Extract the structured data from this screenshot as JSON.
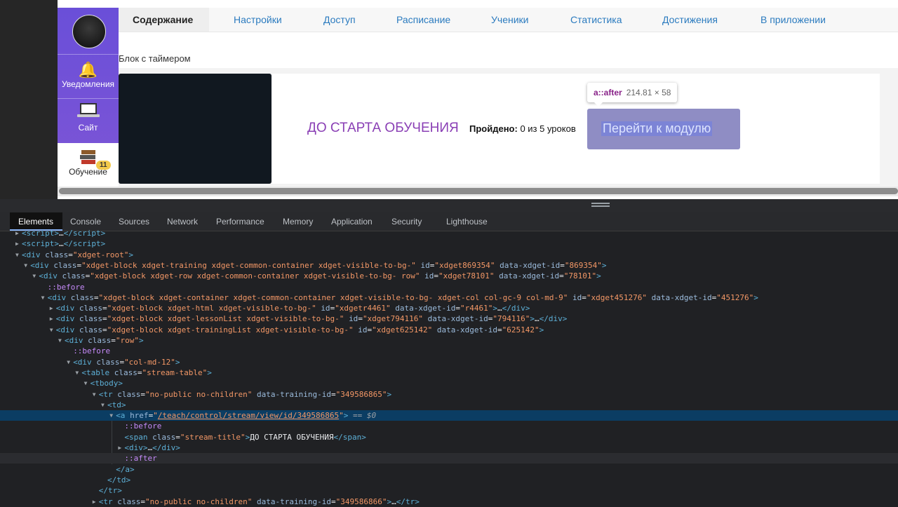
{
  "sidebar": {
    "items": [
      {
        "label": "Уведомления",
        "icon": "bell-icon"
      },
      {
        "label": "Сайт",
        "icon": "laptop-icon"
      },
      {
        "label": "Обучение",
        "icon": "books-icon",
        "badge": "11"
      }
    ]
  },
  "tabs": [
    {
      "label": "Содержание",
      "active": true
    },
    {
      "label": "Настройки"
    },
    {
      "label": "Доступ"
    },
    {
      "label": "Расписание"
    },
    {
      "label": "Ученики"
    },
    {
      "label": "Статистика"
    },
    {
      "label": "Достижения"
    },
    {
      "label": "В приложении"
    }
  ],
  "content": {
    "block_label": "Блок с таймером",
    "stream_title": "ДО СТАРТА ОБУЧЕНИЯ",
    "progress_label": "Пройдено:",
    "progress_value": " 0 из 5 уроков",
    "module_button": "Перейти к модулю"
  },
  "tooltip": {
    "selector": "a::after",
    "size": "214.81 × 58"
  },
  "devtools": {
    "tabs": [
      "Elements",
      "Console",
      "Sources",
      "Network",
      "Performance",
      "Memory",
      "Application",
      "Security",
      "Lighthouse"
    ],
    "active_tab": "Elements",
    "lines": [
      {
        "indent": 0,
        "arrow": "▶",
        "html": "<span class='tag'>&lt;script&gt;</span>…<span class='tag'>&lt;/script&gt;</span>"
      },
      {
        "indent": 0,
        "arrow": "▶",
        "html": "<span class='tag'>&lt;script&gt;</span>…<span class='tag'>&lt;/script&gt;</span>"
      },
      {
        "indent": 0,
        "arrow": "▼",
        "html": "<span class='tag'>&lt;div</span> <span class='attr'>class</span>=<span class='val'>\"xdget-root\"</span><span class='tag'>&gt;</span>"
      },
      {
        "indent": 1,
        "arrow": "▼",
        "html": "<span class='tag'>&lt;div</span> <span class='attr'>class</span>=<span class='val'>\"xdget-block xdget-training xdget-common-container xdget-visible-to-bg-\"</span> <span class='attr'>id</span>=<span class='val'>\"xdget869354\"</span> <span class='attr'>data-xdget-id</span>=<span class='val'>\"869354\"</span><span class='tag'>&gt;</span>"
      },
      {
        "indent": 2,
        "arrow": "▼",
        "html": "<span class='tag'>&lt;div</span> <span class='attr'>class</span>=<span class='val'>\"xdget-block xdget-row xdget-common-container xdget-visible-to-bg- row\"</span> <span class='attr'>id</span>=<span class='val'>\"xdget78101\"</span> <span class='attr'>data-xdget-id</span>=<span class='val'>\"78101\"</span><span class='tag'>&gt;</span>"
      },
      {
        "indent": 3,
        "arrow": "",
        "html": "<span class='pseudo'>::before</span>"
      },
      {
        "indent": 3,
        "arrow": "▼",
        "html": "<span class='tag'>&lt;div</span> <span class='attr'>class</span>=<span class='val'>\"xdget-block xdget-container xdget-common-container xdget-visible-to-bg- xdget-col col-gc-9 col-md-9\"</span> <span class='attr'>id</span>=<span class='val'>\"xdget451276\"</span> <span class='attr'>data-xdget-id</span>=<span class='val'>\"451276\"</span><span class='tag'>&gt;</span>"
      },
      {
        "indent": 4,
        "arrow": "▶",
        "html": "<span class='tag'>&lt;div</span> <span class='attr'>class</span>=<span class='val'>\"xdget-block xdget-html xdget-visible-to-bg-\"</span> <span class='attr'>id</span>=<span class='val'>\"xdgetr4461\"</span> <span class='attr'>data-xdget-id</span>=<span class='val'>\"r4461\"</span><span class='tag'>&gt;</span>…<span class='tag'>&lt;/div&gt;</span>"
      },
      {
        "indent": 4,
        "arrow": "▶",
        "html": "<span class='tag'>&lt;div</span> <span class='attr'>class</span>=<span class='val'>\"xdget-block xdget-lessonList xdget-visible-to-bg-\"</span> <span class='attr'>id</span>=<span class='val'>\"xdget794116\"</span> <span class='attr'>data-xdget-id</span>=<span class='val'>\"794116\"</span><span class='tag'>&gt;</span>…<span class='tag'>&lt;/div&gt;</span>"
      },
      {
        "indent": 4,
        "arrow": "▼",
        "html": "<span class='tag'>&lt;div</span> <span class='attr'>class</span>=<span class='val'>\"xdget-block xdget-trainingList xdget-visible-to-bg-\"</span> <span class='attr'>id</span>=<span class='val'>\"xdget625142\"</span> <span class='attr'>data-xdget-id</span>=<span class='val'>\"625142\"</span><span class='tag'>&gt;</span>"
      },
      {
        "indent": 5,
        "arrow": "▼",
        "html": "<span class='tag'>&lt;div</span> <span class='attr'>class</span>=<span class='val'>\"row\"</span><span class='tag'>&gt;</span>"
      },
      {
        "indent": 6,
        "arrow": "",
        "html": "<span class='pseudo'>::before</span>"
      },
      {
        "indent": 6,
        "arrow": "▼",
        "html": "<span class='tag'>&lt;div</span> <span class='attr'>class</span>=<span class='val'>\"col-md-12\"</span><span class='tag'>&gt;</span>"
      },
      {
        "indent": 7,
        "arrow": "▼",
        "html": "<span class='tag'>&lt;table</span> <span class='attr'>class</span>=<span class='val'>\"stream-table\"</span><span class='tag'>&gt;</span>"
      },
      {
        "indent": 8,
        "arrow": "▼",
        "html": "<span class='tag'>&lt;tbody&gt;</span>"
      },
      {
        "indent": 9,
        "arrow": "▼",
        "html": "<span class='tag'>&lt;tr</span> <span class='attr'>class</span>=<span class='val'>\"no-public no-children\"</span> <span class='attr'>data-training-id</span>=<span class='val'>\"349586865\"</span><span class='tag'>&gt;</span>"
      },
      {
        "indent": 10,
        "arrow": "▼",
        "html": "<span class='tag'>&lt;td&gt;</span>"
      },
      {
        "indent": 11,
        "arrow": "▼",
        "selected": true,
        "html": "<span class='tag'>&lt;a</span> <span class='attr'>href</span>=<span class='val'>\"<u>/teach/control/stream/view/id/349586865</u>\"</span><span class='tag'>&gt;</span> <span class='ref'>== $0</span>"
      },
      {
        "indent": 12,
        "arrow": "",
        "html": "<span class='pseudo'>::before</span>"
      },
      {
        "indent": 12,
        "arrow": "",
        "html": "<span class='tag'>&lt;span</span> <span class='attr'>class</span>=<span class='val'>\"stream-title\"</span><span class='tag'>&gt;</span><span class='txt'>ДО СТАРТА ОБУЧЕНИЯ</span><span class='tag'>&lt;/span&gt;</span>"
      },
      {
        "indent": 12,
        "arrow": "▶",
        "html": "<span class='tag'>&lt;div&gt;</span>…<span class='tag'>&lt;/div&gt;</span>"
      },
      {
        "indent": 12,
        "arrow": "",
        "hover": true,
        "html": "<span class='pseudo'>::after</span>"
      },
      {
        "indent": 11,
        "arrow": "",
        "html": "<span class='tag'>&lt;/a&gt;</span>"
      },
      {
        "indent": 10,
        "arrow": "",
        "html": "<span class='tag'>&lt;/td&gt;</span>"
      },
      {
        "indent": 9,
        "arrow": "",
        "html": "<span class='tag'>&lt;/tr&gt;</span>"
      },
      {
        "indent": 9,
        "arrow": "▶",
        "html": "<span class='tag'>&lt;tr</span> <span class='attr'>class</span>=<span class='val'>\"no-public no-children\"</span> <span class='attr'>data-training-id</span>=<span class='val'>\"349586866\"</span><span class='tag'>&gt;</span>…<span class='tag'>&lt;/tr&gt;</span>"
      }
    ]
  }
}
